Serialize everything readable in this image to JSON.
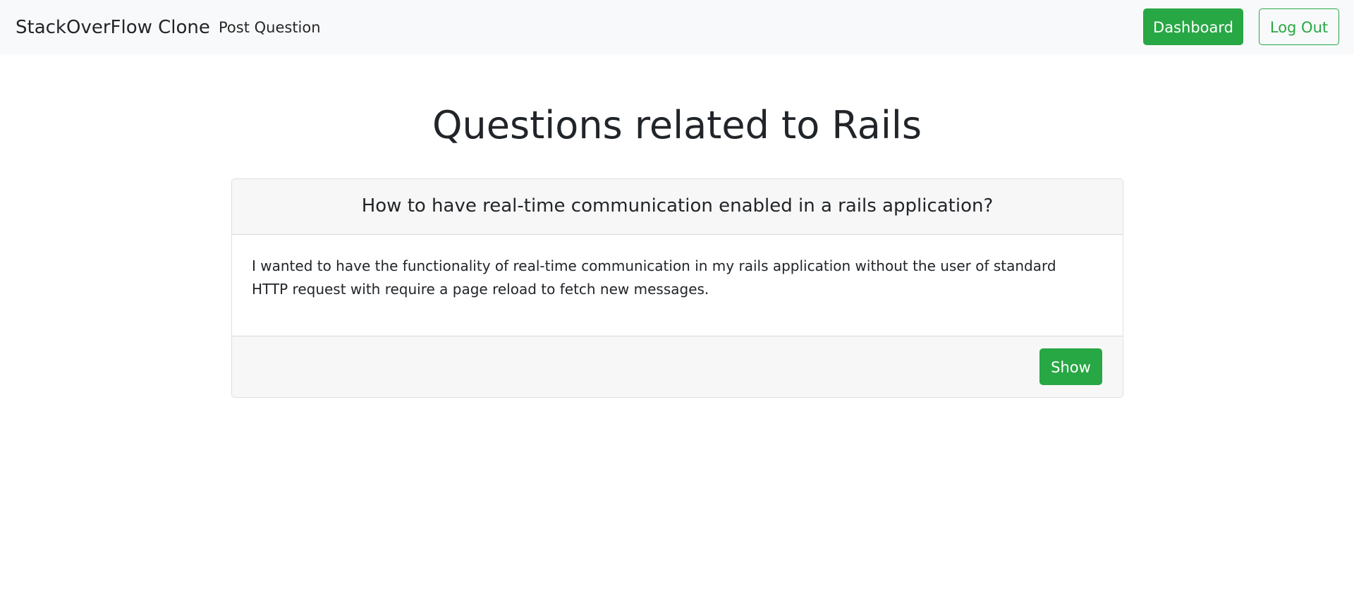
{
  "navbar": {
    "brand": "StackOverFlow Clone",
    "post_question_link": "Post Question",
    "dashboard_button": "Dashboard",
    "logout_button": "Log Out"
  },
  "main": {
    "page_title": "Questions related to Rails",
    "questions": [
      {
        "title": "How to have real-time communication enabled in a rails application?",
        "body": "I wanted to have the functionality of real-time communication in my rails application without the user of standard HTTP request with require a page reload to fetch new messages.",
        "show_button": "Show"
      }
    ]
  },
  "colors": {
    "accent": "#28a745",
    "navbar_bg": "#f8f9fa",
    "text": "#212529"
  }
}
